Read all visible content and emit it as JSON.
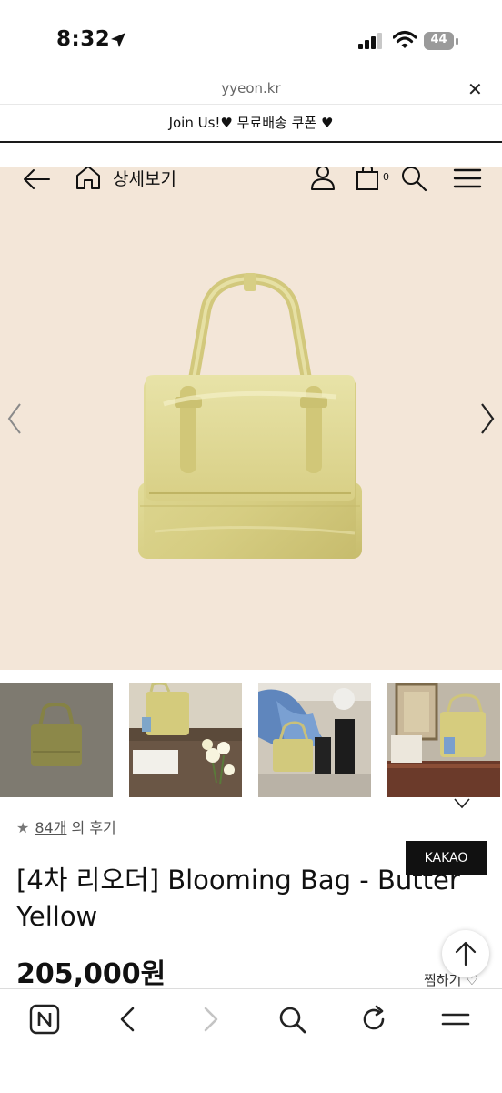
{
  "status_bar": {
    "time": "8:32",
    "battery": "44",
    "icons": [
      "location-arrow-icon",
      "cellular-signal-icon",
      "wifi-icon",
      "battery-icon"
    ]
  },
  "browser": {
    "url": "yyeon.kr",
    "close_icon": "✕"
  },
  "promo": {
    "text": "Join Us!♥ 무료배송 쿠폰 ♥"
  },
  "nav": {
    "title": "상세보기",
    "cart_count": "0",
    "icons": [
      "back-arrow-icon",
      "home-icon",
      "user-icon",
      "cart-icon",
      "search-icon",
      "hamburger-menu-icon"
    ]
  },
  "hero": {
    "image": "butter-yellow-handbag",
    "bg_color": "#f3e6d8",
    "bag_color": "#d9d18a"
  },
  "thumbnails": [
    "bag-on-grey",
    "bag-on-desk-with-flowers",
    "bag-held-by-model",
    "bag-on-shelf-with-art"
  ],
  "reviews": {
    "count_label": "84개",
    "suffix": "의 후기"
  },
  "kakao_label": "KAKAO",
  "product": {
    "name": "[4차 리오더] Blooming Bag - Butter Yellow",
    "price": "205,000원",
    "wish_label": "찜하기 ♡"
  },
  "toolbar": {
    "icons": [
      "naver-n-icon",
      "back-icon",
      "forward-icon",
      "search-icon",
      "reload-icon",
      "menu-icon"
    ]
  }
}
